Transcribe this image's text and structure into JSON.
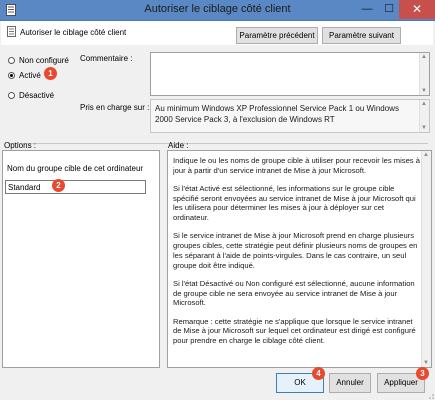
{
  "window": {
    "title": "Autoriser le ciblage côté client",
    "minimize": "—",
    "maximize": "☐",
    "close": "✕"
  },
  "policy": {
    "name": "Autoriser le ciblage côté client",
    "prev_label": "Paramètre précédent",
    "next_label": "Paramètre suivant"
  },
  "state": {
    "options": [
      "Non configuré",
      "Activé",
      "Désactivé"
    ],
    "selected": "Activé"
  },
  "comment": {
    "label": "Commentaire :",
    "value": ""
  },
  "supported": {
    "label": "Pris en charge sur :",
    "value": "Au minimum Windows XP Professionnel Service Pack 1 ou Windows 2000 Service Pack 3, à l'exclusion de Windows RT"
  },
  "options": {
    "label": "Options :",
    "field_label": "Nom du groupe cible de cet ordinateur",
    "field_value": "Standard"
  },
  "help": {
    "label": "Aide :",
    "paragraphs": [
      "Indique le ou les noms de groupe cible à utiliser pour recevoir les mises à jour à partir d'un service intranet de Mise à jour Microsoft.",
      "Si l'état Activé est sélectionné, les informations sur le groupe cible spécifié seront envoyées au service intranet de Mise à jour Microsoft qui les utilisera pour déterminer les mises à jour à déployer sur cet ordinateur.",
      "Si le service intranet de Mise à jour Microsoft prend en charge plusieurs groupes cibles, cette stratégie peut définir plusieurs noms de groupes en les séparant à l'aide de points-virgules. Dans le cas contraire, un seul groupe doit être indiqué.",
      "Si l'état Désactivé ou Non configuré est sélectionné, aucune information de groupe cible ne sera envoyée au service intranet de Mise à jour Microsoft.",
      "Remarque : cette stratégie ne s'applique que lorsque le service intranet de Mise à jour Microsoft sur lequel cet ordinateur est dirigé est configuré pour prendre en charge le ciblage côté client."
    ]
  },
  "buttons": {
    "ok": "OK",
    "cancel": "Annuler",
    "apply": "Appliquer"
  },
  "annotations": [
    "1",
    "2",
    "3",
    "4"
  ],
  "colors": {
    "titlebar": "#5a88c4",
    "close": "#c7504c",
    "badge": "#e8492f"
  }
}
